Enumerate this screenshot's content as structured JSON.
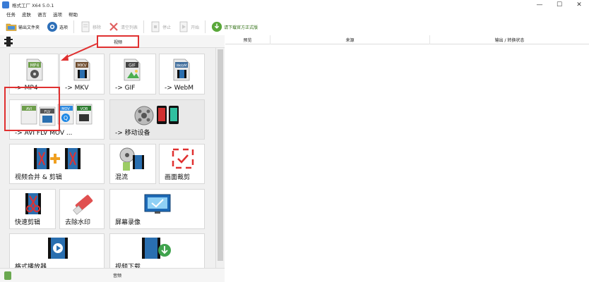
{
  "window": {
    "title": "格式工厂 X64 5.0.1",
    "minimize_glyph": "—",
    "maximize_glyph": "☐",
    "close_glyph": "✕"
  },
  "menu": {
    "items": [
      "任务",
      "皮肤",
      "语言",
      "选项",
      "帮助"
    ]
  },
  "toolbar": {
    "buttons": [
      {
        "label": "输出文件夹",
        "icon": "folder-icon",
        "enabled": true
      },
      {
        "label": "选项",
        "icon": "options-icon",
        "enabled": true
      },
      {
        "label": "移除",
        "icon": "remove-icon",
        "enabled": false
      },
      {
        "label": "清空列表",
        "icon": "clear-list-icon",
        "enabled": false
      },
      {
        "label": "停止",
        "icon": "stop-icon",
        "enabled": false
      },
      {
        "label": "开始",
        "icon": "start-icon",
        "enabled": false
      },
      {
        "label": "请下载官方正式版",
        "icon": "download-icon",
        "enabled": true
      }
    ]
  },
  "left_panel": {
    "category_tab": "视频",
    "footer_label": "音频",
    "tiles": [
      {
        "label": "-> MP4",
        "icon": "mp4-icon"
      },
      {
        "label": "-> MKV",
        "icon": "mkv-icon"
      },
      {
        "label": "-> GIF",
        "icon": "gif-icon"
      },
      {
        "label": "-> WebM",
        "icon": "webm-icon"
      },
      {
        "label": "-> AVI FLV MOV ...",
        "icon": "multi-format-icon"
      },
      {
        "label": "-> 移动设备",
        "icon": "mobile-device-icon"
      },
      {
        "label": "视频合并 & 剪辑",
        "icon": "video-merge-icon"
      },
      {
        "label": "混流",
        "icon": "mux-icon"
      },
      {
        "label": "画面裁剪",
        "icon": "crop-icon"
      },
      {
        "label": "快速剪辑",
        "icon": "quick-clip-icon"
      },
      {
        "label": "去除水印",
        "icon": "remove-watermark-icon"
      },
      {
        "label": "屏幕录像",
        "icon": "screen-record-icon"
      },
      {
        "label": "格式播放器",
        "icon": "player-icon"
      },
      {
        "label": "视频下载",
        "icon": "video-download-icon"
      }
    ]
  },
  "right_panel": {
    "columns": [
      "预览",
      "来源",
      "输出 / 转换状态"
    ]
  },
  "colors": {
    "highlight_red": "#e03030",
    "tile_bg": "#ffffff",
    "panel_bg": "#f0f0f0"
  }
}
